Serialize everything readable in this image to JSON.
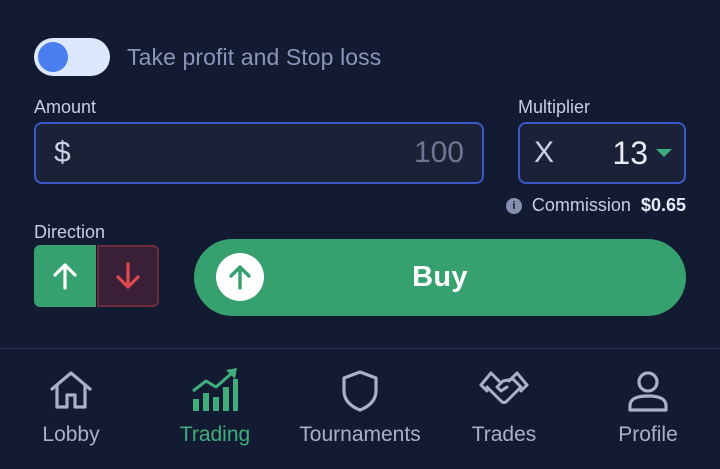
{
  "toggle": {
    "label": "Take profit and Stop loss",
    "on": true
  },
  "amount": {
    "label": "Amount",
    "currency": "$",
    "value": "100"
  },
  "multiplier": {
    "label": "Multiplier",
    "prefix": "X",
    "value": "13"
  },
  "commission": {
    "label": "Commission",
    "value": "$0.65",
    "info_icon": "i"
  },
  "direction": {
    "label": "Direction",
    "up_icon": "arrow-up-icon",
    "down_icon": "arrow-down-icon"
  },
  "buy": {
    "label": "Buy"
  },
  "nav": {
    "items": [
      {
        "label": "Lobby",
        "icon": "home-icon"
      },
      {
        "label": "Trading",
        "icon": "chart-icon",
        "active": true
      },
      {
        "label": "Tournaments",
        "icon": "shield-icon"
      },
      {
        "label": "Trades",
        "icon": "handshake-icon"
      },
      {
        "label": "Profile",
        "icon": "user-icon"
      }
    ]
  },
  "colors": {
    "background": "#131b33",
    "accent_green": "#36a06e",
    "accent_red": "#e0484f",
    "input_border": "#3b58c4",
    "toggle_knob": "#4a7ef0"
  }
}
